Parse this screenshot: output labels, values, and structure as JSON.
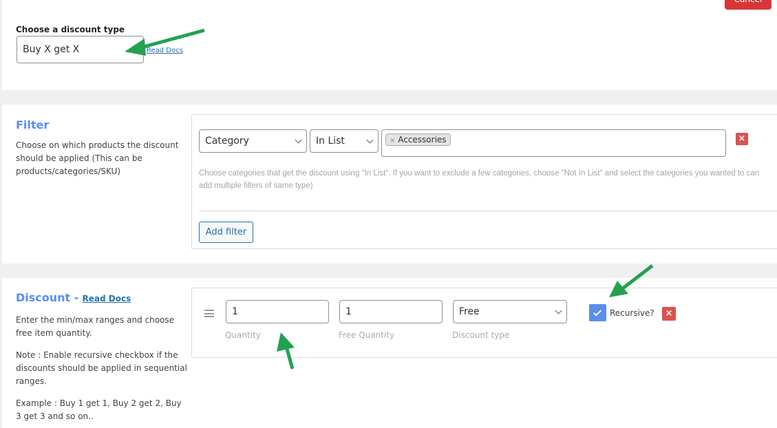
{
  "header": {
    "cancel_label": "Cancel"
  },
  "discount_type": {
    "label": "Choose a discount type",
    "value": "Buy X get X",
    "read_docs": "Read Docs"
  },
  "filter": {
    "title": "Filter",
    "description": "Choose on which products the discount should be applied (This can be products/categories/SKU)",
    "type_value": "Category",
    "operator_value": "In List",
    "tags": [
      "Accessories"
    ],
    "tag_remove": "×",
    "hint_line1": "Choose categories that get the discount using \"In List\". If you want to exclude a few categories, choose \"Not In List\" and select the categories you wanted to",
    "hint_line2": "can add multiple filters of same type)",
    "add_filter": "Add filter",
    "remove": "×"
  },
  "discount": {
    "title": "Discount -",
    "read_docs": "Read Docs",
    "desc1": "Enter the min/max ranges and choose free item quantity.",
    "desc2": "Note : Enable recursive checkbox if the discounts should be applied in sequential ranges.",
    "desc3": "Example : Buy 1 get 1, Buy 2 get 2, Buy 3 get 3 and so on..",
    "quantity": "1",
    "quantity_label": "Quantity",
    "free_quantity": "1",
    "free_quantity_label": "Free Quantity",
    "discount_type": "Free",
    "discount_type_label": "Discount type",
    "recursive_label": "Recursive?",
    "recursive_checked": true,
    "remove": "×"
  },
  "colors": {
    "accent": "#5b8def",
    "danger": "#d9534f",
    "arrow": "#23a150"
  }
}
